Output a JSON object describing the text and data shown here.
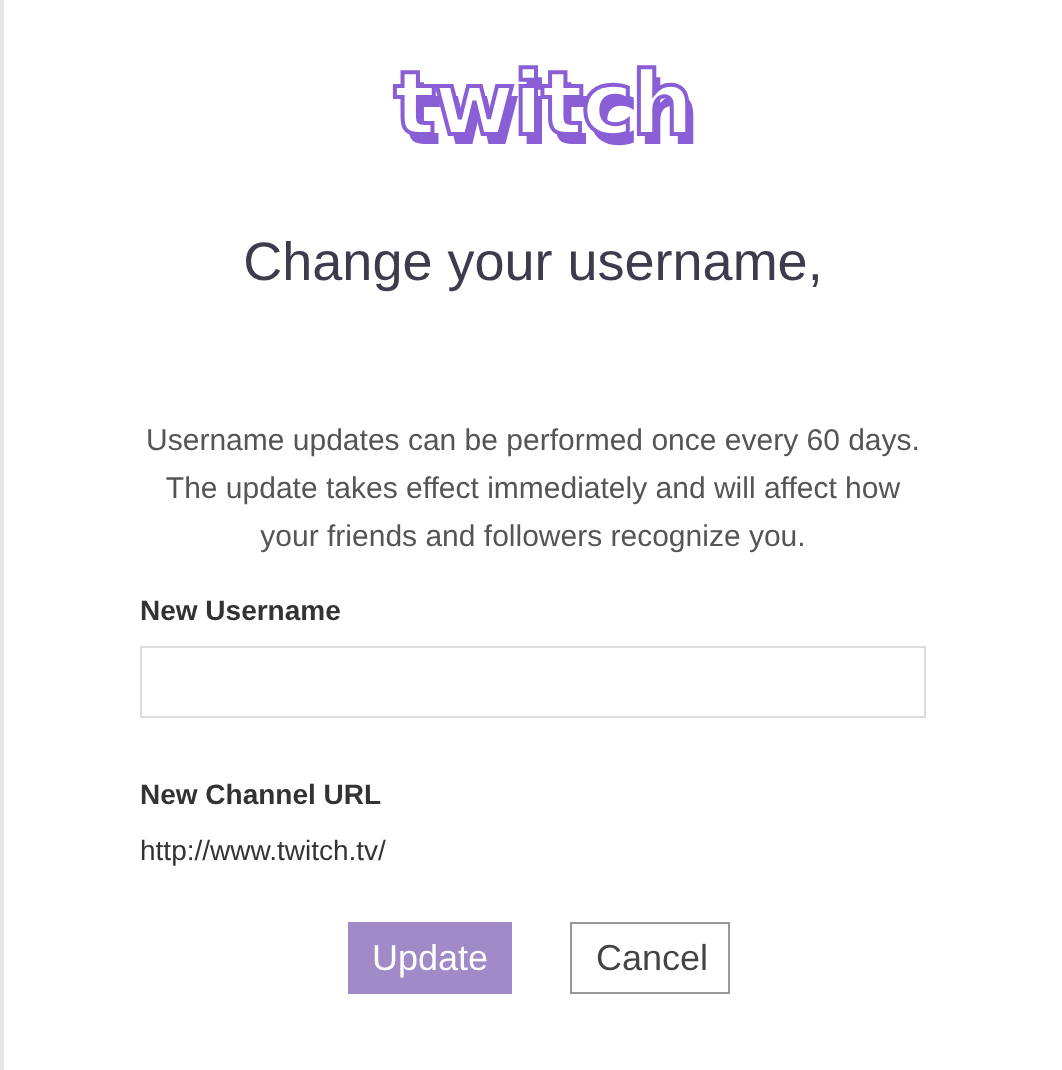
{
  "logo": {
    "text": "twitch"
  },
  "title": "Change your username,",
  "description": "Username updates can be performed once every 60 days. The update takes effect immediately and will affect how your friends and followers recognize you.",
  "username_field": {
    "label": "New Username"
  },
  "channel_url": {
    "label": "New Channel URL",
    "value": "http://www.twitch.tv/"
  },
  "buttons": [
    {
      "kind": "primary",
      "label": "Update",
      "disabled": true
    },
    {
      "kind": "secondary",
      "label": "Cancel",
      "disabled": false
    }
  ]
}
